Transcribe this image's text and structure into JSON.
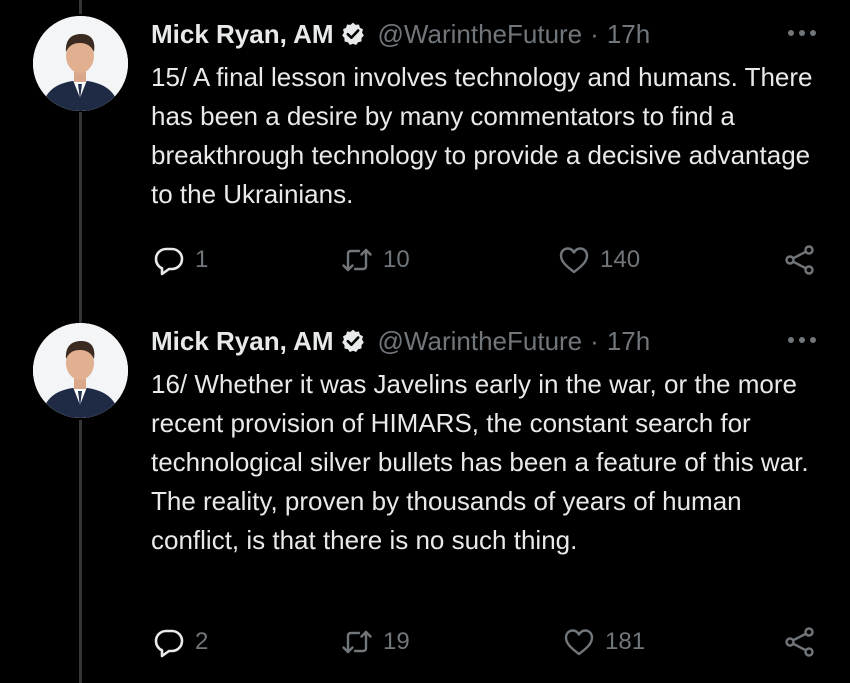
{
  "tweets": [
    {
      "author_name": "Mick Ryan, AM",
      "handle": "@WarintheFuture",
      "separator": "·",
      "time": "17h",
      "text": "15/ A final lesson involves technology and humans. There has been a desire by many commentators to find a breakthrough technology to provide a decisive advantage to the Ukrainians.",
      "replies": "1",
      "retweets": "10",
      "likes": "140"
    },
    {
      "author_name": "Mick Ryan, AM",
      "handle": "@WarintheFuture",
      "separator": "·",
      "time": "17h",
      "text": "16/ Whether it was Javelins early in the war, or the more recent provision of HIMARS, the constant search for technological silver bullets has been a feature of this war. The reality, proven by thousands of years of human conflict, is that there is no such thing.",
      "replies": "2",
      "retweets": "19",
      "likes": "181"
    }
  ],
  "icons": {
    "verified": "verified-badge-icon",
    "more": "more-dots-icon",
    "reply": "reply-icon",
    "retweet": "retweet-icon",
    "like": "like-icon",
    "share": "share-icon"
  },
  "colors": {
    "background": "#000000",
    "text": "#e7e9ea",
    "secondary": "#71767b",
    "thread_line": "#333639"
  }
}
